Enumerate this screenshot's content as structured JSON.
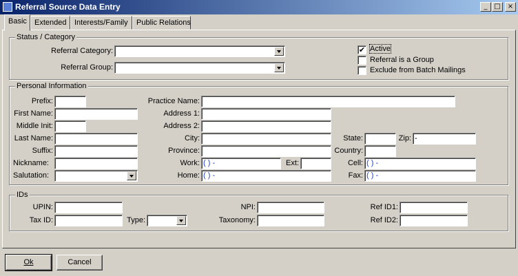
{
  "window": {
    "title": "Referral Source Data Entry",
    "minimize_glyph": "_",
    "maximize_glyph": "□",
    "close_glyph": "×"
  },
  "tabs": [
    {
      "label": "Basic",
      "active": true
    },
    {
      "label": "Extended",
      "active": false
    },
    {
      "label": "Interests/Family",
      "active": false
    },
    {
      "label": "Public Relations",
      "active": false
    }
  ],
  "status_category": {
    "legend": "Status / Category",
    "referral_category_label": "Referral Category:",
    "referral_category_value": "",
    "referral_group_label": "Referral Group:",
    "referral_group_value": "",
    "active": {
      "label": "Active",
      "checked": true,
      "mark": "✔"
    },
    "is_group": {
      "label": "Referral is a Group",
      "checked": false
    },
    "exclude_batch": {
      "label": "Exclude from Batch Mailings",
      "checked": false
    }
  },
  "personal": {
    "legend": "Personal Information",
    "prefix_label": "Prefix:",
    "prefix_value": "",
    "first_name_label": "First Name:",
    "first_name_value": "",
    "middle_init_label": "Middle Init:",
    "middle_init_value": "",
    "last_name_label": "Last Name:",
    "last_name_value": "",
    "suffix_label": "Suffix:",
    "suffix_value": "",
    "nickname_label": "Nickname:",
    "nickname_value": "",
    "salutation_label": "Salutation:",
    "salutation_value": "",
    "practice_name_label": "Practice Name:",
    "practice_name_value": "",
    "address1_label": "Address 1:",
    "address1_value": "",
    "address2_label": "Address 2:",
    "address2_value": "",
    "city_label": "City:",
    "city_value": "",
    "province_label": "Province:",
    "province_value": "",
    "work_label": "Work:",
    "work_value": "(   )     -",
    "ext_label": "Ext:",
    "ext_value": "",
    "home_label": "Home:",
    "home_value": "(   )     -",
    "state_label": "State:",
    "state_value": "",
    "zip_label": "Zip:",
    "zip_value": "       -",
    "country_label": "Country:",
    "country_value": "",
    "cell_label": "Cell:",
    "cell_value": "(   )     -",
    "fax_label": "Fax:",
    "fax_value": "(   )     -"
  },
  "ids": {
    "legend": "IDs",
    "upin_label": "UPIN:",
    "upin_value": "",
    "tax_id_label": "Tax ID:",
    "tax_id_value": "",
    "type_label": "Type:",
    "type_value": "",
    "npi_label": "NPI:",
    "npi_value": "",
    "taxonomy_label": "Taxonomy:",
    "taxonomy_value": "",
    "ref_id1_label": "Ref ID1:",
    "ref_id1_value": "",
    "ref_id2_label": "Ref ID2:",
    "ref_id2_value": ""
  },
  "buttons": {
    "ok": "Ok",
    "cancel": "Cancel"
  }
}
